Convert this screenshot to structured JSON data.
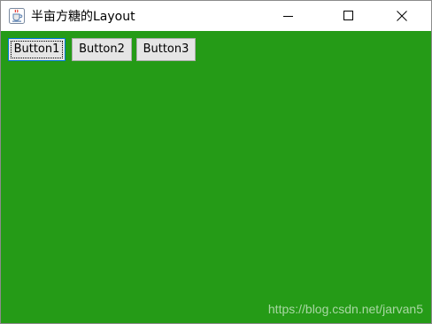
{
  "window": {
    "title": "半亩方糖的Layout",
    "app_icon": "java-coffee-icon",
    "controls": {
      "minimize_icon": "minimize-icon",
      "maximize_icon": "maximize-icon",
      "close_icon": "close-icon"
    }
  },
  "content": {
    "background_color": "#259b17",
    "buttons": [
      {
        "label": "Button1",
        "focused": true
      },
      {
        "label": "Button2",
        "focused": false
      },
      {
        "label": "Button3",
        "focused": false
      }
    ]
  },
  "watermark": {
    "text": "https://blog.csdn.net/jarvan5"
  }
}
